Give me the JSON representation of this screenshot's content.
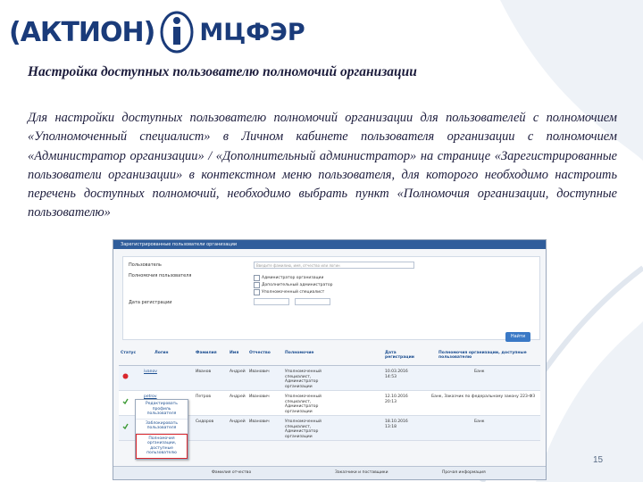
{
  "logo": {
    "left": "(АКТИОН)",
    "right": "МЦФЭР"
  },
  "title": "Настройка доступных пользователю полномочий организации",
  "paragraph": "Для настройки доступных пользователю полномочий организации для пользователей с полномочием «Уполномоченный специалист» в Личном кабинете пользователя организации с полномочием «Администратор организации» / «Дополнительный администратор» на странице «Зарегистрированные пользователи организации» в контекстном меню пользователя, для которого необходимо настроить перечень доступных полномочий, необходимо выбрать пункт «Полномочия организации, доступные пользователю»",
  "page_number": "15",
  "screenshot": {
    "header": "Зарегистрированные пользователи организации",
    "form": {
      "user_label": "Пользователь",
      "user_placeholder": "Введите фамилию, имя, отчество или логин",
      "rights_label": "Полномочия пользователя",
      "checks": [
        "Администратор организации",
        "Дополнительный администратор",
        "Уполномоченный специалист"
      ],
      "date_label": "Дата регистрации",
      "search_button": "Найти"
    },
    "columns": [
      "Статус",
      "Логин",
      "Фамилия",
      "Имя",
      "Отчество",
      "Полномочие",
      "Дата регистрации",
      "Полномочия организации, доступные пользователю"
    ],
    "rows": [
      {
        "status": "blocked",
        "login": "ivanov",
        "lastname": "Иванов",
        "name": "Андрей",
        "patronymic": "Иванович",
        "rights": "Уполномоченный специалист, Администратор организации",
        "date": "10.03.2016 14:53",
        "org_rights": "Банк"
      },
      {
        "status": "ok",
        "login": "petrov",
        "lastname": "Петров",
        "name": "Андрей",
        "patronymic": "Иванович",
        "rights": "Уполномоченный специалист, Администратор организации",
        "date": "12.10.2016 20:13",
        "org_rights": "Банк, Заказчик по федеральному закону 223-ФЗ"
      },
      {
        "status": "ok",
        "login": "sidorov",
        "lastname": "Сидоров",
        "name": "Андрей",
        "patronymic": "Иванович",
        "rights": "Уполномоченный специалист, Администратор организации",
        "date": "18.10.2016 13:18",
        "org_rights": "Банк"
      }
    ],
    "context_menu": [
      "Редактировать профиль пользователя",
      "Заблокировать пользователя",
      "Полномочия организации, доступные пользователю"
    ],
    "footer": [
      "Фамилия отчество",
      "Заказчики и поставщики",
      "Прочая информация"
    ]
  }
}
